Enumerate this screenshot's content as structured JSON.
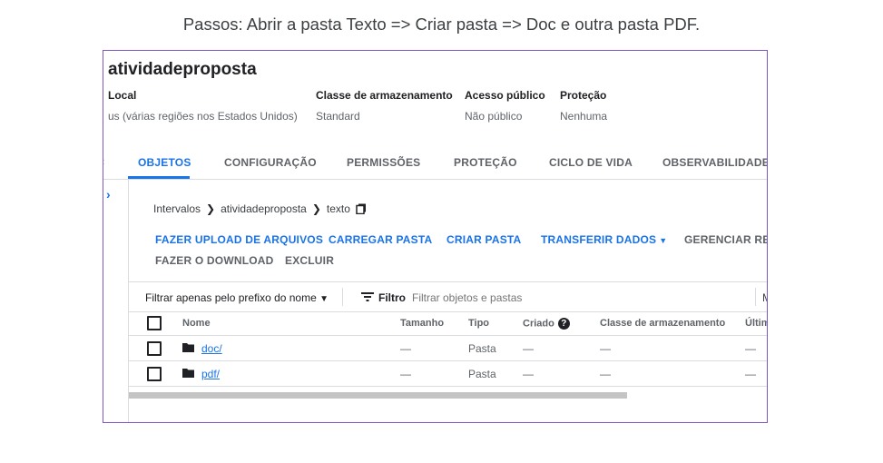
{
  "caption": "Passos: Abrir a pasta Texto => Criar pasta => Doc e outra pasta PDF.",
  "bucket": {
    "name": "atividadeproposta",
    "location_label": "Local",
    "location_value": "us (várias regiões nos Estados Unidos)",
    "storage_class_label": "Classe de armazenamento",
    "storage_class_value": "Standard",
    "public_access_label": "Acesso público",
    "public_access_value": "Não público",
    "protection_label": "Proteção",
    "protection_value": "Nenhuma"
  },
  "tabs": [
    {
      "label": "OBJETOS",
      "active": true
    },
    {
      "label": "CONFIGURAÇÃO",
      "active": false
    },
    {
      "label": "PERMISSÕES",
      "active": false
    },
    {
      "label": "PROTEÇÃO",
      "active": false
    },
    {
      "label": "CICLO DE VIDA",
      "active": false
    },
    {
      "label": "OBSERVABILIDADE",
      "active": false
    }
  ],
  "breadcrumb": {
    "items": [
      "Intervalos",
      "atividadeproposta",
      "texto"
    ],
    "separator": "❯"
  },
  "actions": {
    "upload_files": "FAZER UPLOAD DE ARQUIVOS",
    "upload_folder": "CARREGAR PASTA",
    "create_folder": "CRIAR PASTA",
    "transfer_data": "TRANSFERIR DADOS",
    "manage_retention": "GERENCIAR RETE",
    "download": "FAZER O DOWNLOAD",
    "delete": "EXCLUIR"
  },
  "filter": {
    "prefix_label": "Filtrar apenas pelo prefixo do nome",
    "filter_label": "Filtro",
    "placeholder": "Filtrar objetos e pastas",
    "right_cut": "M"
  },
  "table": {
    "headers": {
      "name": "Nome",
      "size": "Tamanho",
      "type": "Tipo",
      "created": "Criado",
      "storage_class": "Classe de armazenamento",
      "last": "Últim"
    },
    "rows": [
      {
        "name": "doc/",
        "size": "—",
        "type": "Pasta",
        "created": "—",
        "storage_class": "—",
        "last": "—"
      },
      {
        "name": "pdf/",
        "size": "—",
        "type": "Pasta",
        "created": "—",
        "storage_class": "—",
        "last": "—"
      }
    ]
  },
  "colors": {
    "accent": "#1a73e8",
    "frame": "#7e57c2"
  }
}
